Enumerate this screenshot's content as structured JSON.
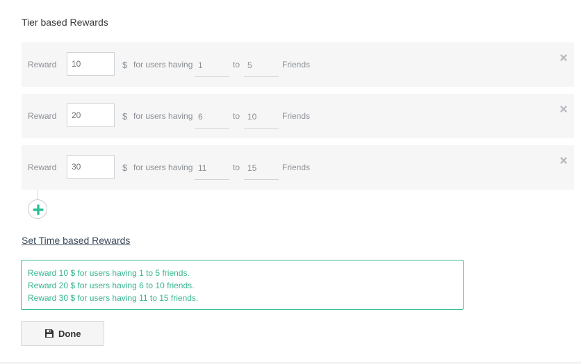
{
  "section_title": "Tier based Rewards",
  "tiers": [
    {
      "reward_label": "Reward",
      "reward_value": "10",
      "currency": "$",
      "users_label": "for users having",
      "from_value": "1",
      "to_label": "to",
      "to_value": "5",
      "unit_label": "Friends",
      "remove_icon": "close-icon"
    },
    {
      "reward_label": "Reward",
      "reward_value": "20",
      "currency": "$",
      "users_label": "for users having",
      "from_value": "6",
      "to_label": "to",
      "to_value": "10",
      "unit_label": "Friends",
      "remove_icon": "close-icon"
    },
    {
      "reward_label": "Reward",
      "reward_value": "30",
      "currency": "$",
      "users_label": "for users having",
      "from_value": "11",
      "to_label": "to",
      "to_value": "15",
      "unit_label": "Friends",
      "remove_icon": "close-icon"
    }
  ],
  "add_tier_icon": "plus-icon",
  "time_link": "Set Time based Rewards",
  "summary": [
    "Reward 10 $ for users having 1 to 5 friends.",
    "Reward 20 $ for users having 6 to 10 friends.",
    "Reward 30 $ for users having 11 to 15 friends."
  ],
  "done_button": {
    "icon": "save-icon",
    "label": "Done"
  },
  "colors": {
    "accent": "#35b48f",
    "row_background": "#f6f6f6",
    "link": "#3b4a5a"
  }
}
